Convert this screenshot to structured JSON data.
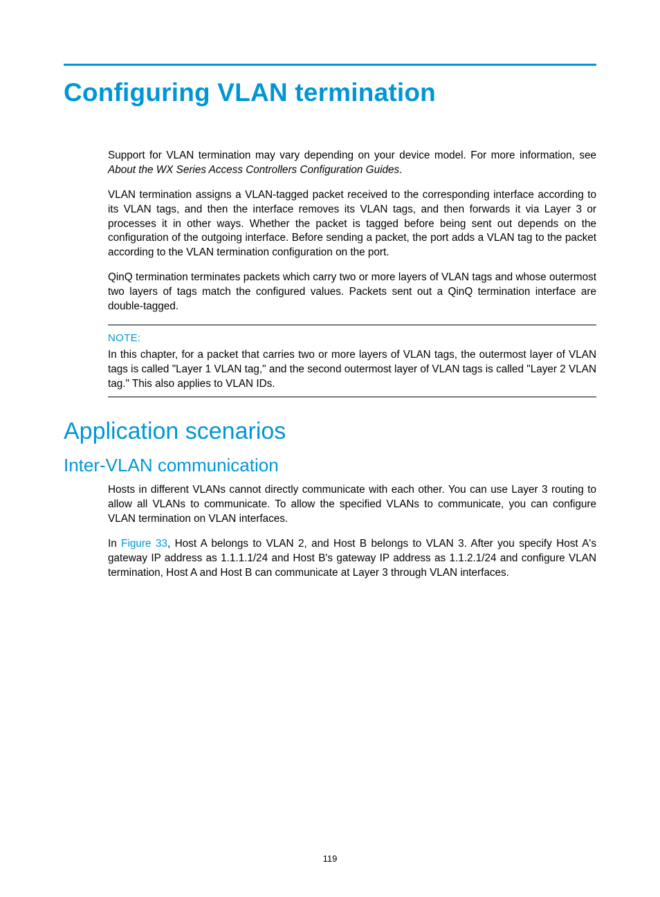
{
  "title": "Configuring VLAN termination",
  "intro": {
    "p1_a": "Support for VLAN termination may vary depending on your device model. For more information, see ",
    "p1_b_italic": "About the WX Series Access Controllers Configuration Guides",
    "p1_c": ".",
    "p2": "VLAN termination assigns a VLAN-tagged packet received to the corresponding interface according to its VLAN tags, and then the interface removes its VLAN tags, and then forwards it via Layer 3 or processes it in other ways. Whether the packet is tagged before being sent out depends on the configuration of the outgoing interface. Before sending a packet, the port adds a VLAN tag to the packet according to the VLAN termination configuration on the port.",
    "p3": "QinQ termination terminates packets which carry two or more layers of VLAN tags and whose outermost two layers of tags match the configured values. Packets sent out a QinQ termination interface are double-tagged."
  },
  "note": {
    "label": "NOTE:",
    "text": "In this chapter, for a packet that carries two or more layers of VLAN tags, the outermost layer of VLAN tags is called \"Layer 1 VLAN tag,\" and the second outermost layer of VLAN tags is called \"Layer 2 VLAN tag.\" This also applies to VLAN IDs."
  },
  "section2": {
    "heading": "Application scenarios",
    "subheading": "Inter-VLAN communication",
    "p1": "Hosts in different VLANs cannot directly communicate with each other. You can use Layer 3 routing to allow all VLANs to communicate. To allow the specified VLANs to communicate, you can configure VLAN termination on VLAN interfaces.",
    "p2_a": "In ",
    "p2_link": "Figure 33",
    "p2_b": ", Host A belongs to VLAN 2, and Host B belongs to VLAN 3. After you specify Host A's gateway IP address as 1.1.1.1/24 and Host B's gateway IP address as 1.1.2.1/24 and configure VLAN termination, Host A and Host B can communicate at Layer 3 through VLAN interfaces."
  },
  "page_number": "119"
}
